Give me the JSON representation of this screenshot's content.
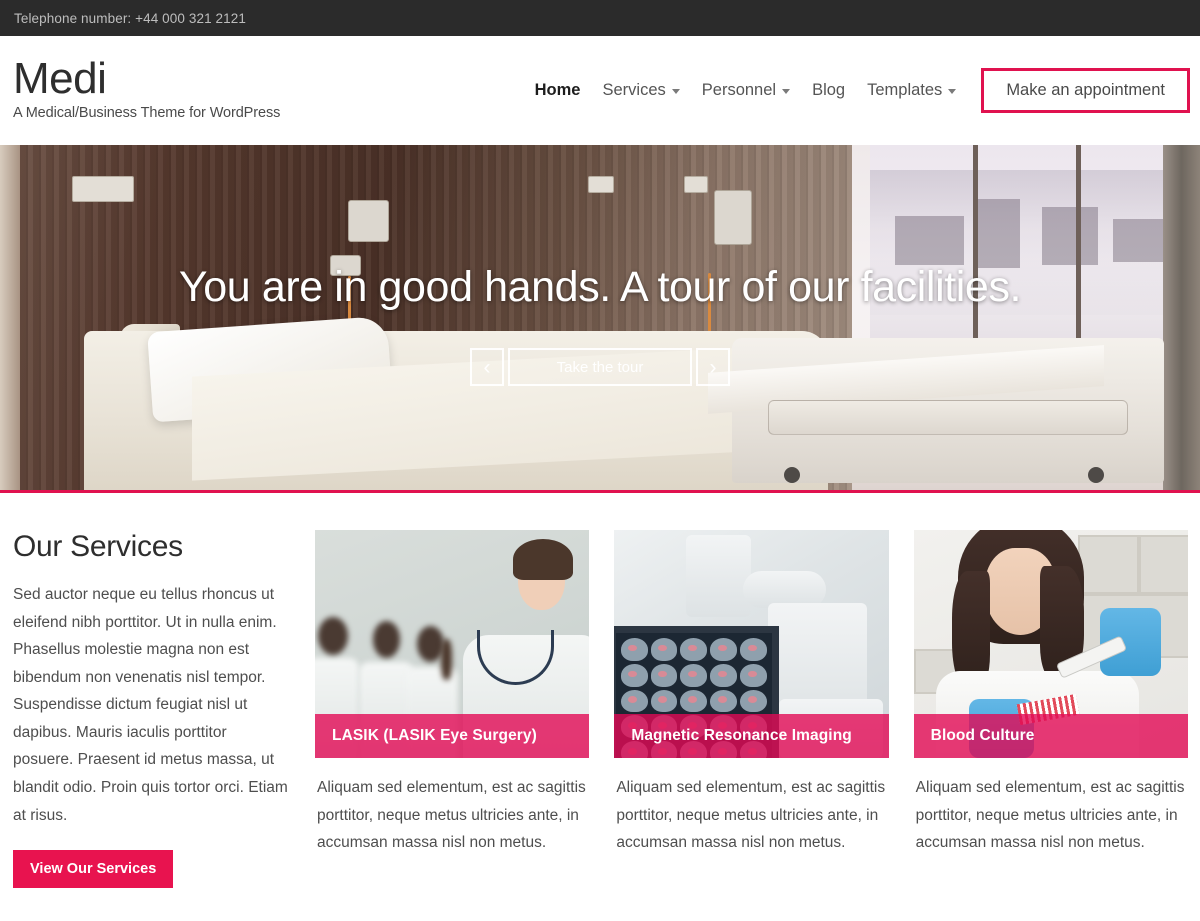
{
  "topbar": {
    "phone_label": "Telephone number: +44 000 321 2121"
  },
  "brand": {
    "title": "Medi",
    "tagline": "A Medical/Business Theme for WordPress"
  },
  "nav": {
    "items": [
      {
        "label": "Home",
        "active": true,
        "has_caret": false
      },
      {
        "label": "Services",
        "active": false,
        "has_caret": true
      },
      {
        "label": "Personnel",
        "active": false,
        "has_caret": true
      },
      {
        "label": "Blog",
        "active": false,
        "has_caret": false
      },
      {
        "label": "Templates",
        "active": false,
        "has_caret": true
      }
    ],
    "appointment_label": "Make an appointment"
  },
  "hero": {
    "title": "You are in good hands. A tour of our facilities.",
    "tour_label": "Take the tour",
    "prev_glyph": "‹",
    "next_glyph": "›"
  },
  "services": {
    "heading": "Our Services",
    "intro": "Sed auctor neque eu tellus rhoncus ut eleifend nibh porttitor. Ut in nulla enim. Phasellus molestie magna non est bibendum non venenatis nisl tempor. Suspendisse dictum feugiat nisl ut dapibus. Mauris iaculis porttitor posuere. Praesent id metus massa, ut blandit odio. Proin quis tortor orci. Etiam at risus.",
    "button_label": "View Our Services",
    "cards": [
      {
        "label": "LASIK (LASIK Eye Surgery)",
        "description": "Aliquam sed elementum, est ac sagittis porttitor, neque metus ultricies ante, in accumsan massa nisl non metus."
      },
      {
        "label": "Magnetic Resonance Imaging",
        "description": "Aliquam sed elementum, est ac sagittis porttitor, neque metus ultricies ante, in accumsan massa nisl non metus."
      },
      {
        "label": "Blood Culture",
        "description": "Aliquam sed elementum, est ac sagittis porttitor, neque metus ultricies ante, in accumsan massa nisl non metus."
      }
    ]
  },
  "colors": {
    "accent_pink": "#e8134f",
    "accent_border": "#e0124f",
    "topbar_bg": "#2b2b2b",
    "card_overlay": "rgba(226,10,85,0.80)"
  }
}
